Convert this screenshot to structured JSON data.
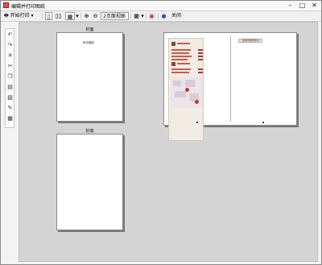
{
  "window": {
    "title": "编辑并打印图纸",
    "controls": {
      "minimize": "–",
      "maximize": "□",
      "close": "✕"
    }
  },
  "toolbar": {
    "start_print": "开始打印",
    "page_view": "2页面视图",
    "close": "关闭"
  },
  "pages": {
    "front_label": "封面",
    "back_label": "封底",
    "front_text": "杭州酒店",
    "spread_chip": "活动内容和时间"
  },
  "icons": {
    "printer": "printer-icon",
    "dropdown": "chevron-down-icon",
    "help": "help-icon"
  },
  "colors": {
    "canvas": "#d4d4d4",
    "menu_red": "#c85a4c",
    "help_blue": "#1f5fbf"
  }
}
